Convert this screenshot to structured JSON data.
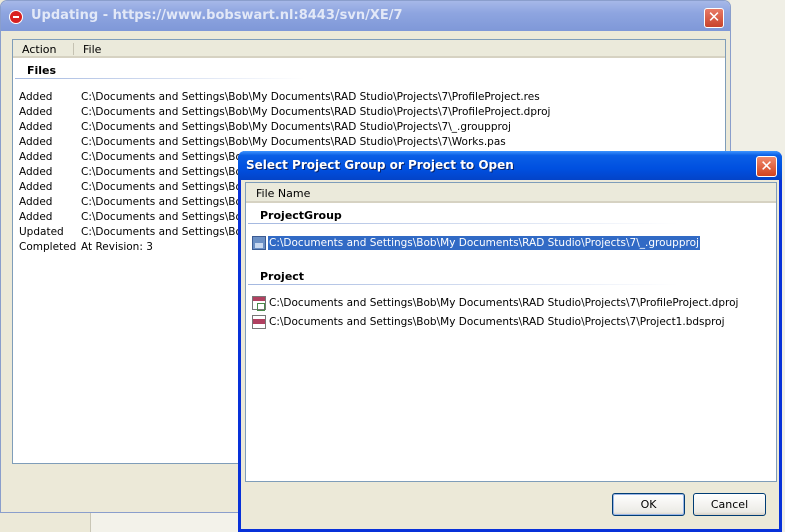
{
  "updating_window": {
    "title": "Updating - https://www.bobswart.nl:8443/svn/XE/7",
    "close_glyph": "✕",
    "columns": {
      "action": "Action",
      "file": "File"
    },
    "group_label": "Files",
    "rows": [
      {
        "action": "Added",
        "file": "C:\\Documents and Settings\\Bob\\My Documents\\RAD Studio\\Projects\\7\\ProfileProject.res"
      },
      {
        "action": "Added",
        "file": "C:\\Documents and Settings\\Bob\\My Documents\\RAD Studio\\Projects\\7\\ProfileProject.dproj"
      },
      {
        "action": "Added",
        "file": "C:\\Documents and Settings\\Bob\\My Documents\\RAD Studio\\Projects\\7\\_.groupproj"
      },
      {
        "action": "Added",
        "file": "C:\\Documents and Settings\\Bob\\My Documents\\RAD Studio\\Projects\\7\\Works.pas"
      },
      {
        "action": "Added",
        "file": "C:\\Documents and Settings\\Bob\\M"
      },
      {
        "action": "Added",
        "file": "C:\\Documents and Settings\\Bob\\M"
      },
      {
        "action": "Added",
        "file": "C:\\Documents and Settings\\Bob\\M"
      },
      {
        "action": "Added",
        "file": "C:\\Documents and Settings\\Bob\\M"
      },
      {
        "action": "Added",
        "file": "C:\\Documents and Settings\\Bob\\M"
      },
      {
        "action": "Updated",
        "file": "C:\\Documents and Settings\\Bob\\M"
      },
      {
        "action": "Completed",
        "file": "At Revision: 3"
      }
    ]
  },
  "select_dialog": {
    "title": "Select Project Group or Project to Open",
    "close_glyph": "✕",
    "column": "File Name",
    "groups": {
      "project_group": {
        "label": "ProjectGroup",
        "items": [
          {
            "icon": "project-group-icon",
            "path": "C:\\Documents and Settings\\Bob\\My Documents\\RAD Studio\\Projects\\7\\_.groupproj",
            "selected": true
          }
        ]
      },
      "project": {
        "label": "Project",
        "items": [
          {
            "icon": "dproj-file-icon",
            "path": "C:\\Documents and Settings\\Bob\\My Documents\\RAD Studio\\Projects\\7\\ProfileProject.dproj"
          },
          {
            "icon": "bdsproj-file-icon",
            "path": "C:\\Documents and Settings\\Bob\\My Documents\\RAD Studio\\Projects\\7\\Project1.bdsproj"
          }
        ]
      }
    },
    "buttons": {
      "ok": "OK",
      "cancel": "Cancel"
    }
  },
  "colors": {
    "active_title": "#0054e3",
    "inactive_title": "#8ea5e0",
    "selection": "#316ac5"
  }
}
